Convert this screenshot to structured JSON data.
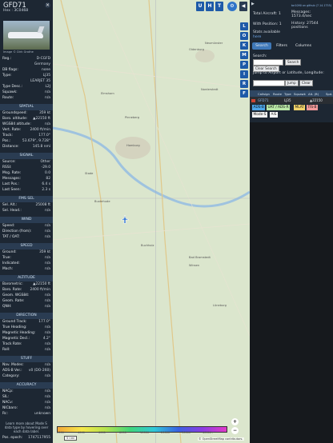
{
  "aircraft": {
    "callsign": "GFD71",
    "hex_label": "Hex : 3C0468",
    "close_glyph": "×",
    "photo_credit": "Image © Dirk Grothe"
  },
  "info_rows": [
    {
      "k": "Reg.:",
      "v": "D-CGFD"
    },
    {
      "k": "",
      "v": "Germany"
    },
    {
      "k": "DB flags:",
      "v": "none"
    },
    {
      "k": "Type:",
      "v": "LJ35"
    },
    {
      "k": "",
      "v": "LEARJET 35"
    },
    {
      "k": "Type Desc.:",
      "v": "L2J"
    },
    {
      "k": "Squawk:",
      "v": "n/a"
    },
    {
      "k": "Route:",
      "v": "n/a"
    }
  ],
  "sections": {
    "spatial": {
      "title": "SPATIAL",
      "rows": [
        {
          "k": "Groundspeed:",
          "v": "359 kt"
        },
        {
          "k": "Baro. altitude:",
          "v": "▲22150 ft"
        },
        {
          "k": "WGS84 altitude:",
          "v": "n/a"
        },
        {
          "k": "Vert. Rate:",
          "v": "2400 ft/min"
        },
        {
          "k": "Track:",
          "v": "177.0°"
        },
        {
          "k": "Pos.:",
          "v": "53.679°, 9.728°"
        },
        {
          "k": "Distance:",
          "v": "145.8 nmi"
        }
      ]
    },
    "signal": {
      "title": "SIGNAL",
      "rows": [
        {
          "k": "Source:",
          "v": "Other"
        },
        {
          "k": "RSSI:",
          "v": "-29.0"
        },
        {
          "k": "Msg. Rate:",
          "v": "0.0"
        },
        {
          "k": "Messages:",
          "v": "82"
        },
        {
          "k": "Last Pos.:",
          "v": "6.4 s"
        },
        {
          "k": "Last Seen:",
          "v": "2.3 s"
        }
      ]
    },
    "fms": {
      "title": "FMS SEL",
      "rows": [
        {
          "k": "Sel. Alt.:",
          "v": "25008 ft"
        },
        {
          "k": "Sel. Head.:",
          "v": "n/a"
        }
      ]
    },
    "wind": {
      "title": "WIND",
      "rows": [
        {
          "k": "Speed:",
          "v": "n/a"
        },
        {
          "k": "Direction (from):",
          "v": "n/a"
        },
        {
          "k": "TAT / OAT:",
          "v": "n/a"
        }
      ]
    },
    "speed": {
      "title": "SPEED",
      "rows": [
        {
          "k": "Ground:",
          "v": "359 kt"
        },
        {
          "k": "True:",
          "v": "n/a"
        },
        {
          "k": "Indicated:",
          "v": "n/a"
        },
        {
          "k": "Mach:",
          "v": "n/a"
        }
      ]
    },
    "altitude": {
      "title": "ALTITUDE",
      "rows": [
        {
          "k": "Barometric:",
          "v": "▲22150 ft"
        },
        {
          "k": "Baro. Rate:",
          "v": "2400 ft/min"
        },
        {
          "k": "Geom. WGS84:",
          "v": "n/a"
        },
        {
          "k": "Geom. Rate:",
          "v": "n/a"
        },
        {
          "k": "QNH:",
          "v": "n/a"
        }
      ]
    },
    "direction": {
      "title": "DIRECTION",
      "rows": [
        {
          "k": "Ground Track:",
          "v": "177.0°"
        },
        {
          "k": "True Heading:",
          "v": "n/a"
        },
        {
          "k": "Magnetic Heading:",
          "v": "n/a"
        },
        {
          "k": "Magnetic Decl.:",
          "v": "4.2°"
        },
        {
          "k": "Track Rate:",
          "v": "n/a"
        },
        {
          "k": "Roll:",
          "v": "n/a"
        }
      ]
    },
    "stuff": {
      "title": "STUFF",
      "rows": [
        {
          "k": "Nav. Modes:",
          "v": "n/a"
        },
        {
          "k": "ADS-B Ver.:",
          "v": "v0 (DO-260)"
        },
        {
          "k": "Category:",
          "v": "n/a"
        }
      ]
    },
    "accuracy": {
      "title": "ACCURACY",
      "rows": [
        {
          "k": "NACp:",
          "v": "n/a"
        },
        {
          "k": "SIL:",
          "v": "n/a"
        },
        {
          "k": "NACv:",
          "v": "n/a"
        },
        {
          "k": "NICbaro:",
          "v": "n/a"
        },
        {
          "k": "Rc:",
          "v": "unknown"
        }
      ]
    }
  },
  "learn_more": "Learn more about Mode S data type by hovering over each data label.",
  "pos_epoch": {
    "k": "Pos. epoch:",
    "v": "1747117955"
  },
  "map": {
    "top_buttons": [
      "U",
      "H",
      "T"
    ],
    "side_buttons": [
      "L",
      "O",
      "K",
      "M",
      "P",
      "I",
      "R",
      "F"
    ],
    "nav_left": "◀",
    "nav_right": "▶",
    "zoom_in": "+",
    "zoom_out": "−",
    "scale": "5 nmi",
    "attribution": "© OpenStreetMap contributors.",
    "places": [
      "Oldenburg",
      "Neumünster",
      "Norderstedt",
      "Hamburg",
      "Stade",
      "Buxtehude",
      "Buchholz",
      "Bad Bramstedt",
      "Elmshorn",
      "Pinneberg",
      "Winsen",
      "Lüneburg"
    ],
    "legend_ticks": [
      "2000",
      "4000",
      "6000",
      "8000",
      "10000",
      "20000",
      "30000",
      "40000+"
    ]
  },
  "stats": {
    "version": "tar1090 on github (7.14.1755)",
    "total_label": "Total Aircraft:",
    "total_value": "1",
    "messages_label": "Messages:",
    "messages_value": "1573.4/sec",
    "position_label": "With Position:",
    "position_value": "1",
    "history_label": "History:",
    "history_value": "27544 positions",
    "stats_available": "Stats available",
    "here": "here"
  },
  "tabs": [
    "Search",
    "Filters",
    "Columns"
  ],
  "search": {
    "label": "Search:",
    "button": "Search",
    "clear_search": "Clear Search",
    "jump_label": "Jump to Airport or Latitude, Longitude:",
    "jump_button": "Jump",
    "clear_button": "Clear"
  },
  "table": {
    "headers": [
      "Callsign",
      "Route",
      "Type",
      "Squawk",
      "Alt. (ft)",
      "Spd."
    ],
    "rows": [
      {
        "callsign": "GFD71",
        "route": "",
        "type": "LJ35",
        "squawk": "",
        "alt": "▲22150",
        "spd": ""
      }
    ]
  },
  "badges": [
    {
      "label": "ADS-B",
      "bg": "#4da5e8"
    },
    {
      "label": "UAT / ADS-R",
      "bg": "#b9e6a6"
    },
    {
      "label": "MLAT",
      "bg": "#f2d36b"
    },
    {
      "label": "TIS-B",
      "bg": "#f29a9a"
    },
    {
      "label": "Mode-S",
      "bg": "#f1f1f1"
    },
    {
      "label": "AIS",
      "bg": "#ffffff"
    }
  ]
}
